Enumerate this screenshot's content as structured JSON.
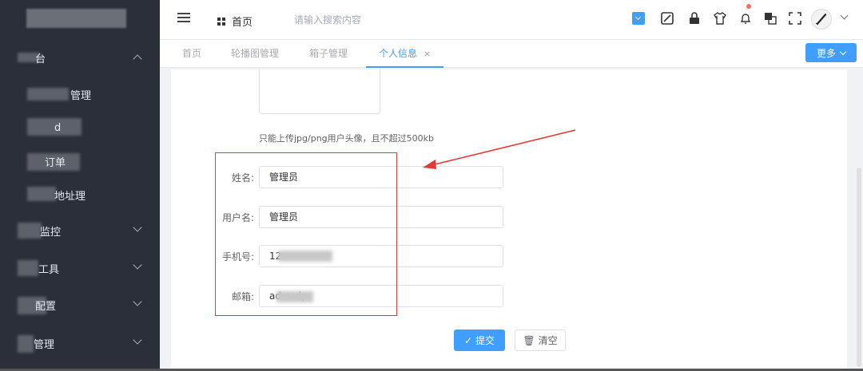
{
  "header": {
    "home": "首页",
    "search_placeholder": "请输入搜索内容"
  },
  "sidebar": {
    "items": [
      {
        "label": "台"
      },
      {
        "label": "理"
      },
      {
        "label": "管理"
      },
      {
        "label": "d"
      },
      {
        "label": "订单"
      },
      {
        "label": "地址理"
      },
      {
        "label": "监控"
      },
      {
        "label": "工具"
      },
      {
        "label": "配置"
      },
      {
        "label": "管理"
      }
    ]
  },
  "tabs": [
    {
      "label": "首页"
    },
    {
      "label": "轮播图管理"
    },
    {
      "label": "箱子管理"
    },
    {
      "label": "个人信息",
      "close": "×"
    }
  ],
  "more_button": "更多",
  "form": {
    "hint": "只能上传jpg/png用户头像，且不超过500kb",
    "name_label": "姓名:",
    "name_value": "管理员",
    "username_label": "用户名:",
    "username_value": "管理员",
    "phone_label": "手机号:",
    "phone_value": "12",
    "email_label": "邮箱:",
    "email_value": "ad          x.vip",
    "submit": "提交",
    "clear": "清空"
  },
  "colors": {
    "primary": "#409eff",
    "sidebar": "#2b2f3a",
    "annotation": "#e53935"
  }
}
